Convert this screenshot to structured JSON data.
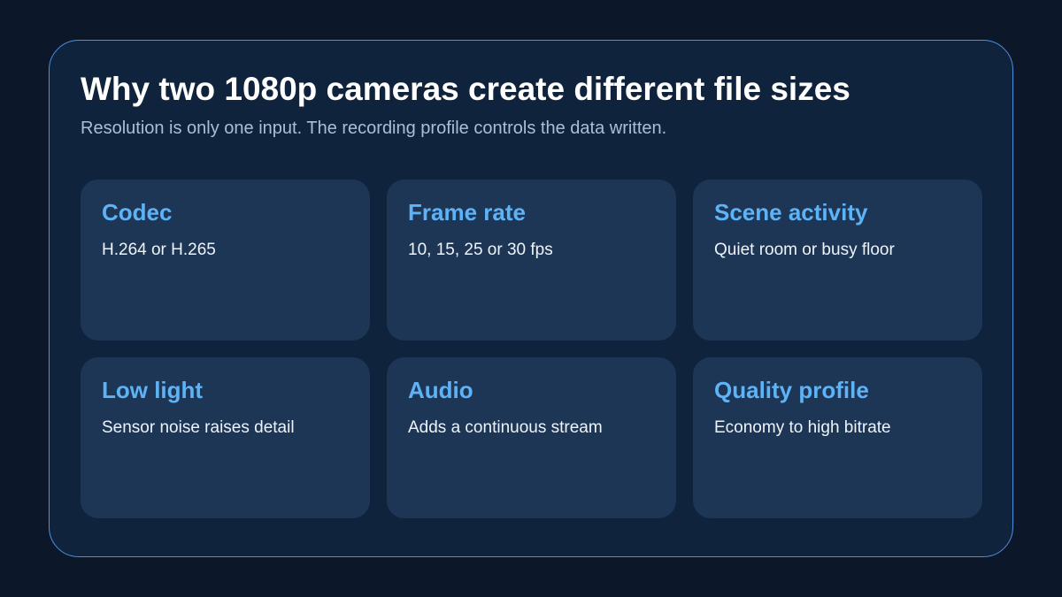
{
  "header": {
    "title": "Why two 1080p cameras create different file sizes",
    "subtitle": "Resolution is only one input. The recording profile controls the data written."
  },
  "cards": [
    {
      "title": "Codec",
      "desc": "H.264 or H.265"
    },
    {
      "title": "Frame rate",
      "desc": "10, 15, 25 or 30 fps"
    },
    {
      "title": "Scene activity",
      "desc": "Quiet room or busy floor"
    },
    {
      "title": "Low light",
      "desc": "Sensor noise raises detail"
    },
    {
      "title": "Audio",
      "desc": "Adds a continuous stream"
    },
    {
      "title": "Quality profile",
      "desc": "Economy to high bitrate"
    }
  ],
  "colors": {
    "background": "#0c172a",
    "panel": "#10233d",
    "panel_border": "#4d8fe0",
    "card": "#1e3656",
    "accent": "#5eb3f7",
    "subtitle": "#a9bfd9"
  }
}
